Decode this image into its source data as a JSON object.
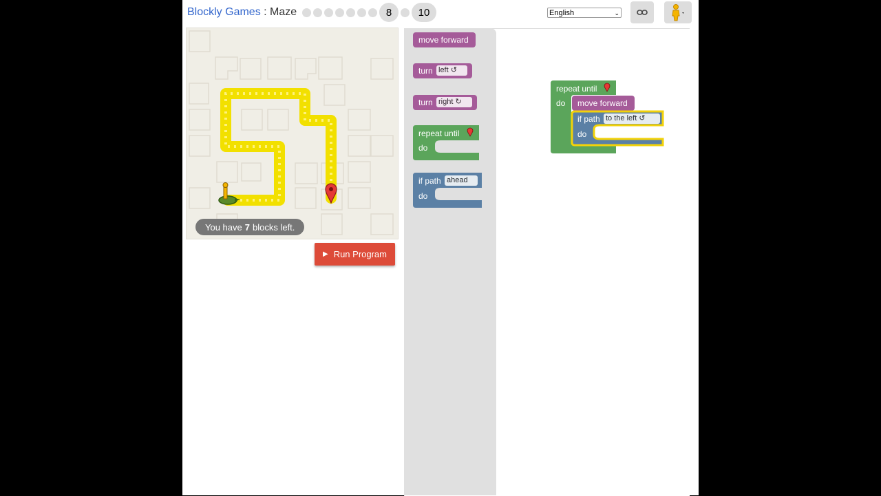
{
  "header": {
    "site_link": "Blockly Games",
    "separator": " : ",
    "game_name": "Maze",
    "levels": {
      "current": "8",
      "max": "10"
    },
    "language": "English"
  },
  "icons": {
    "link": "link-icon",
    "pegman": "pegman-icon",
    "marker": "map-marker-icon",
    "pegman_start": "pegman-start-icon",
    "run": "play-icon"
  },
  "maze": {
    "capacity": {
      "prefix": "You have",
      "count": "7",
      "suffix": "blocks left."
    }
  },
  "controls": {
    "run_program": "Run Program"
  },
  "toolbox": {
    "move_forward": "move forward",
    "turn": "turn",
    "turn_left": "left ↺",
    "turn_right": "right ↻",
    "repeat_until": "repeat until",
    "do": "do",
    "if_path": "if path",
    "ahead": "ahead"
  },
  "program": {
    "repeat_until": "repeat until",
    "do": "do",
    "move_forward": "move forward",
    "if_path": "if path",
    "to_the_left": "to the left ↺",
    "inner_do": "do"
  },
  "colors": {
    "movement": "#a55b99",
    "loop": "#5ba55b",
    "logic": "#5b80a5",
    "path": "#ffea00",
    "run_button": "#dd4b39"
  }
}
